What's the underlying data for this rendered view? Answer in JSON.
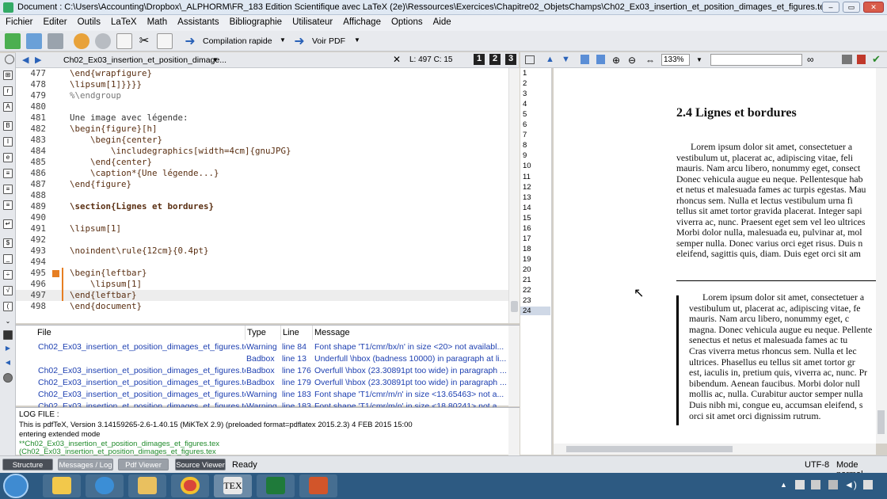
{
  "window": {
    "title": "Document : C:\\Users\\Accounting\\Dropbox\\_ALPHORM\\FR_183 Edition Scientifique avec LaTeX (2e)\\Ressources\\Exercices\\Chapitre02_ObjetsChamps\\Ch02_Ex03_insertion_et_position_dimages_et_figures.tex"
  },
  "menu": [
    "Fichier",
    "Editer",
    "Outils",
    "LaTeX",
    "Math",
    "Assistants",
    "Bibliographie",
    "Utilisateur",
    "Affichage",
    "Options",
    "Aide"
  ],
  "toolbar": {
    "compile_label": "Compilation rapide",
    "view_label": "Voir PDF"
  },
  "editor": {
    "tab_name": "Ch02_Ex03_insertion_et_position_dimage...",
    "cursor": "L: 497 C: 15",
    "view_buttons": [
      "1",
      "2",
      "3"
    ],
    "lines": [
      {
        "n": "477",
        "t": "\\end{wrapfigure}"
      },
      {
        "n": "478",
        "t": "\\lipsum[1]}}}}"
      },
      {
        "n": "479",
        "t": "%\\endgroup"
      },
      {
        "n": "480",
        "t": ""
      },
      {
        "n": "481",
        "t": "Une image avec légende:"
      },
      {
        "n": "482",
        "t": "\\begin{figure}[h]"
      },
      {
        "n": "483",
        "t": "    \\begin{center}"
      },
      {
        "n": "484",
        "t": "        \\includegraphics[width=4cm]{gnuJPG}"
      },
      {
        "n": "485",
        "t": "    \\end{center}"
      },
      {
        "n": "486",
        "t": "    \\caption*{Une légende...}"
      },
      {
        "n": "487",
        "t": "\\end{figure}"
      },
      {
        "n": "488",
        "t": ""
      },
      {
        "n": "489",
        "t": "\\section{Lignes et bordures}"
      },
      {
        "n": "490",
        "t": ""
      },
      {
        "n": "491",
        "t": "\\lipsum[1]"
      },
      {
        "n": "492",
        "t": ""
      },
      {
        "n": "493",
        "t": "\\noindent\\rule{12cm}{0.4pt}"
      },
      {
        "n": "494",
        "t": ""
      },
      {
        "n": "495",
        "t": "\\begin{leftbar}"
      },
      {
        "n": "496",
        "t": "    \\lipsum[1]"
      },
      {
        "n": "497",
        "t": "\\end{leftbar}"
      },
      {
        "n": "498",
        "t": "\\end{document}"
      }
    ]
  },
  "messages": {
    "headers": [
      "File",
      "Type",
      "Line",
      "Message"
    ],
    "rows": [
      {
        "file": "Ch02_Ex03_insertion_et_position_dimages_et_figures.tex",
        "type": "Warning",
        "line": "line 84",
        "msg": "Font shape 'T1/cmr/bx/n' in size <20> not availabl..."
      },
      {
        "file": "",
        "type": "Badbox",
        "line": "line 13",
        "msg": "Underfull \\hbox (badness 10000) in paragraph at li..."
      },
      {
        "file": "Ch02_Ex03_insertion_et_position_dimages_et_figures.tex",
        "type": "Badbox",
        "line": "line 176",
        "msg": "Overfull \\hbox (23.30891pt too wide) in paragraph ..."
      },
      {
        "file": "Ch02_Ex03_insertion_et_position_dimages_et_figures.tex",
        "type": "Badbox",
        "line": "line 179",
        "msg": "Overfull \\hbox (23.30891pt too wide) in paragraph ..."
      },
      {
        "file": "Ch02_Ex03_insertion_et_position_dimages_et_figures.tex",
        "type": "Warning",
        "line": "line 183",
        "msg": "Font shape 'T1/cmr/m/n' in size <13.65463> not a..."
      },
      {
        "file": "Ch02_Ex03_insertion_et_position_dimages_et_figures.tex",
        "type": "Warning",
        "line": "line 183",
        "msg": "Font shape 'T1/cmr/m/n' in size <18.80241> not a..."
      }
    ]
  },
  "log": {
    "label": "LOG FILE :",
    "lines": [
      "This is pdfTeX, Version 3.14159265-2.6-1.40.15 (MiKTeX 2.9) (preloaded format=pdflatex 2015.2.3) 4 FEB 2015 15:00",
      "entering extended mode",
      "**Ch02_Ex03_insertion_et_position_dimages_et_figures.tex",
      "(Ch02_Ex03_insertion_et_position_dimages_et_figures.tex"
    ]
  },
  "pdf": {
    "zoom": "133%",
    "page_numbers": [
      "1",
      "2",
      "3",
      "4",
      "5",
      "6",
      "7",
      "8",
      "9",
      "10",
      "11",
      "12",
      "13",
      "14",
      "15",
      "16",
      "17",
      "18",
      "19",
      "20",
      "21",
      "22",
      "23",
      "24"
    ],
    "heading": "2.4 Lignes et bordures",
    "para1": [
      "Lorem ipsum dolor sit amet, consectetuer a",
      "vestibulum ut, placerat ac, adipiscing vitae, feli",
      "mauris. Nam arcu libero, nonummy eget, consect",
      "Donec vehicula augue eu neque. Pellentesque hab",
      "et netus et malesuada fames ac turpis egestas. Mau",
      "rhoncus sem. Nulla et lectus vestibulum urna fi",
      "tellus sit amet tortor gravida placerat. Integer sapi",
      "viverra ac, nunc. Praesent eget sem vel leo ultrices",
      "Morbi dolor nulla, malesuada eu, pulvinar at, mol",
      "semper nulla. Donec varius orci eget risus. Duis n",
      "eleifend, sagittis quis, diam. Duis eget orci sit am"
    ],
    "para2": [
      "Lorem ipsum dolor sit amet, consectetuer a",
      "vestibulum ut, placerat ac, adipiscing vitae, fe",
      "mauris. Nam arcu libero, nonummy eget, c",
      "magna. Donec vehicula augue eu neque. Pellente",
      "senectus et netus et malesuada fames ac tu",
      "Cras viverra metus rhoncus sem. Nulla et lec",
      "ultrices. Phasellus eu tellus sit amet tortor gr",
      "est, iaculis in, pretium quis, viverra ac, nunc. Pr",
      "bibendum. Aenean faucibus. Morbi dolor null",
      "mollis ac, nulla. Curabitur auctor semper nulla",
      "Duis nibh mi, congue eu, accumsan eleifend, s",
      "orci sit amet orci dignissim rutrum."
    ]
  },
  "status": {
    "tabs": [
      "Structure",
      "Messages / Log",
      "Pdf Viewer",
      "Source Viewer"
    ],
    "ready": "Ready",
    "encoding": "UTF-8",
    "mode": "Mode normal"
  },
  "taskbar": {
    "apps": [
      "start-orb-icon",
      "file-explorer-icon",
      "internet-explorer-icon",
      "folder-icon",
      "chrome-icon",
      "texmaker-icon",
      "excel-icon",
      "powerpoint-icon"
    ],
    "tex_label": "TEX"
  },
  "colors": {
    "accent": "#2d5a82",
    "kw": "#5a2f12",
    "link": "#1d3fb0",
    "marker": "#e67e22"
  }
}
